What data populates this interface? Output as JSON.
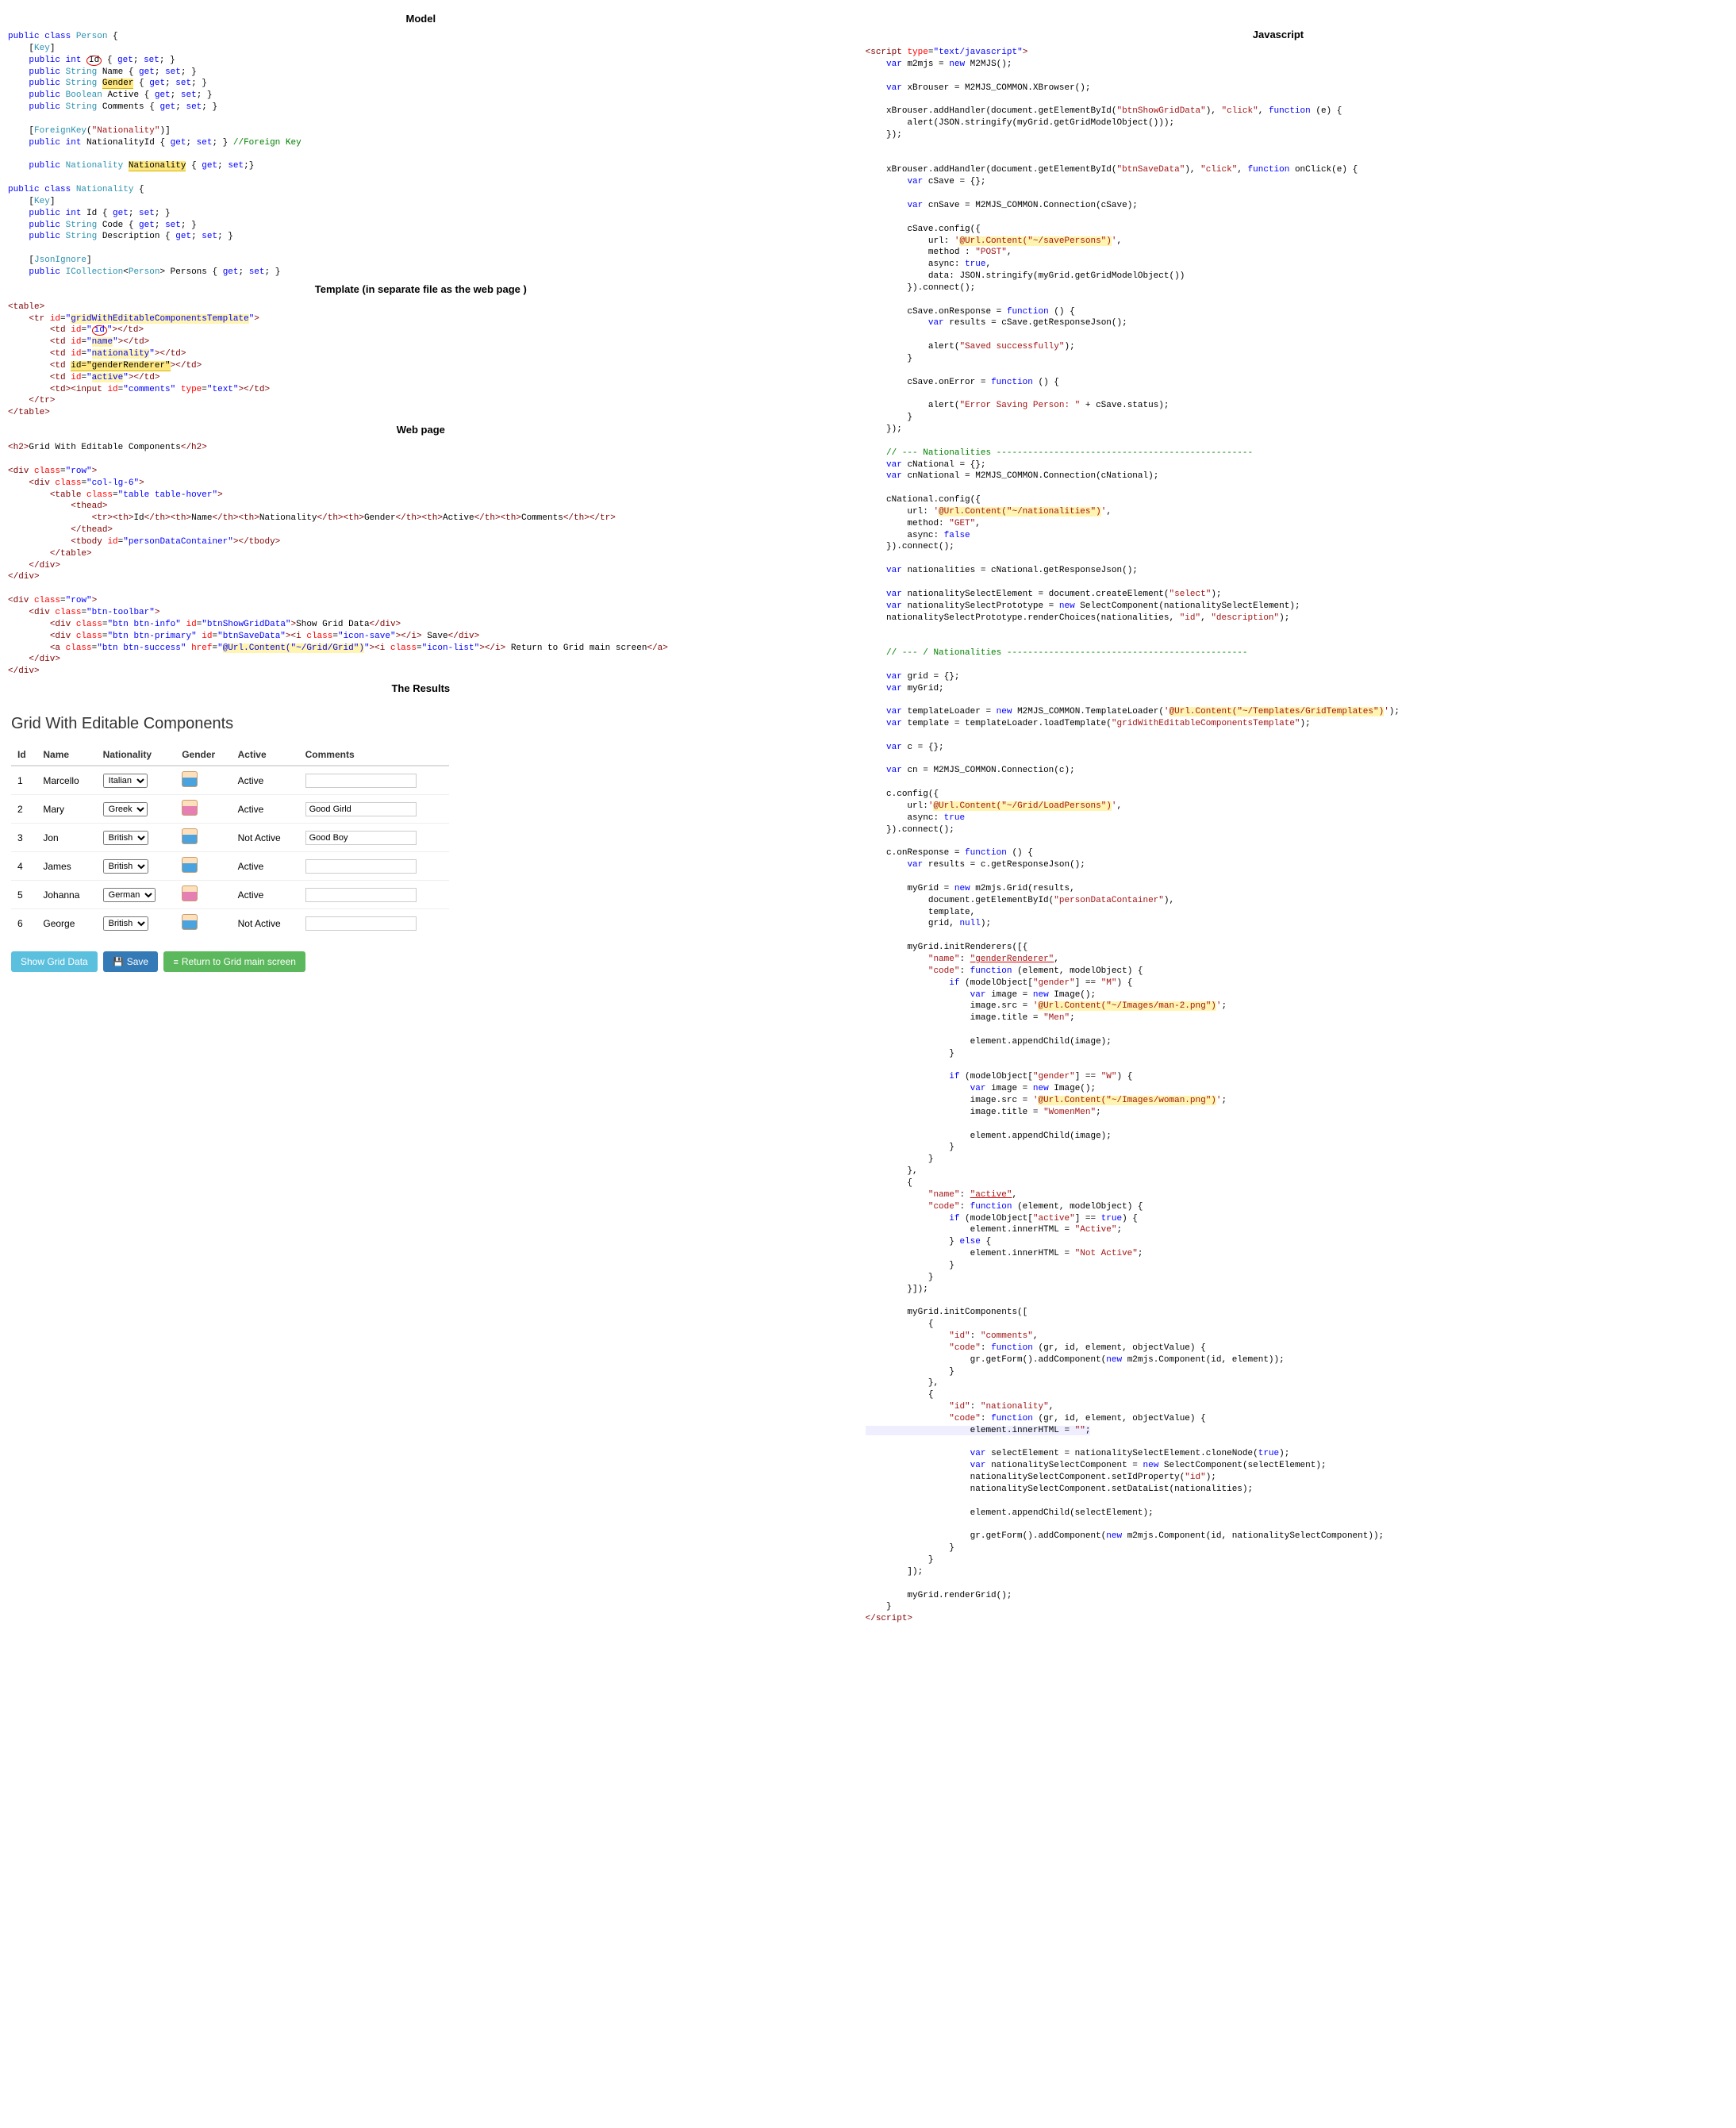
{
  "headings": {
    "model": "Model",
    "template": "Template (in separate file as the web page )",
    "webpage": "Web page",
    "results": "The Results",
    "javascript": "Javascript"
  },
  "model_code": {
    "l1": "public class Person {",
    "l2": "    [Key]",
    "l3a": "    public int ",
    "l3b": "Id",
    "l3c": " { get; set; }",
    "l4": "    public String Name { get; set; }",
    "l5a": "    public String ",
    "l5b": "Gender",
    "l5c": " { get; set; }",
    "l6": "    public Boolean Active { get; set; }",
    "l7": "    public String Comments { get; set; }",
    "l8": "",
    "l9": "    [ForeignKey(\"Nationality\")]",
    "l10a": "    public int NationalityId { get; set; } ",
    "l10b": "//Foreign Key",
    "l11": "",
    "l12a": "    public Nationality ",
    "l12b": "Nationality",
    "l12c": " { get; set;}",
    "l13": "",
    "n1": "public class Nationality {",
    "n2": "    [Key]",
    "n3": "    public int Id { get; set; }",
    "n4": "    public String Code { get; set; }",
    "n5": "    public String Description { get; set; }",
    "n6": "",
    "n7": "    [JsonIgnore]",
    "n8": "    public ICollection<Person> Persons { get; set; }"
  },
  "template_code": {
    "t1": "<table>",
    "t2": "    <tr id=\"gridWithEditableComponentsTemplate\">",
    "t3a": "        <td id=\"",
    "t3b": "id",
    "t3c": "\"></td>",
    "t4": "        <td id=\"name\"></td>",
    "t5a": "        <td id=\"",
    "t5b": "nationality",
    "t5c": "\"></td>",
    "t6a": "        <td ",
    "t6b": "id=\"genderRenderer\"",
    "t6c": "></td>",
    "t7a": "        <td id=\"",
    "t7b": "active",
    "t7c": "\"></td>",
    "t8": "        <td><input id=\"comments\" type=\"text\"></td>",
    "t9": "    </tr>",
    "t10": "</table>"
  },
  "webpage_code": {
    "w1": "<h2>Grid With Editable Components</h2>",
    "w2": "",
    "w3": "<div class=\"row\">",
    "w4": "    <div class=\"col-lg-6\">",
    "w5": "        <table class=\"table table-hover\">",
    "w6": "            <thead>",
    "w7": "                <tr><th>Id</th><th>Name</th><th>Nationality</th><th>Gender</th><th>Active</th><th>Comments</th></tr>",
    "w8": "            </thead>",
    "w9": "            <tbody id=\"personDataContainer\"></tbody>",
    "w10": "        </table>",
    "w11": "    </div>",
    "w12": "</div>",
    "w13": "",
    "w14": "<div class=\"row\">",
    "w15": "    <div class=\"btn-toolbar\">",
    "w16": "        <div class=\"btn btn-info\" id=\"btnShowGridData\">Show Grid Data</div>",
    "w17": "        <div class=\"btn btn-primary\" id=\"btnSaveData\"><i class=\"icon-save\"></i> Save</div>",
    "w18a": "        <a class=\"btn btn-success\" href=\"",
    "w18b": "@Url.Content(\"~/Grid/Grid\")",
    "w18c": "\"><i class=\"icon-list\"></i> Return to Grid main screen</a>",
    "w19": "    </div>",
    "w20": "</div>"
  },
  "results": {
    "title": "Grid With Editable Components",
    "columns": [
      "Id",
      "Name",
      "Nationality",
      "Gender",
      "Active",
      "Comments"
    ],
    "rows": [
      {
        "id": "1",
        "name": "Marcello",
        "nat": "Italian",
        "gender": "M",
        "active": "Active",
        "comments": ""
      },
      {
        "id": "2",
        "name": "Mary",
        "nat": "Greek",
        "gender": "F",
        "active": "Active",
        "comments": "Good Girld"
      },
      {
        "id": "3",
        "name": "Jon",
        "nat": "British",
        "gender": "M",
        "active": "Not Active",
        "comments": "Good Boy"
      },
      {
        "id": "4",
        "name": "James",
        "nat": "British",
        "gender": "M",
        "active": "Active",
        "comments": ""
      },
      {
        "id": "5",
        "name": "Johanna",
        "nat": "German",
        "gender": "F",
        "active": "Active",
        "comments": ""
      },
      {
        "id": "6",
        "name": "George",
        "nat": "British",
        "gender": "M",
        "active": "Not Active",
        "comments": ""
      }
    ],
    "buttons": {
      "show": "Show Grid Data",
      "save": "Save",
      "return": "Return to Grid main screen"
    }
  },
  "js": {
    "open": "<script type=\"text/javascript\">",
    "j1": "    var m2mjs = new M2MJS();",
    "j2": "",
    "j3": "    var xBrouser = M2MJS_COMMON.XBrowser();",
    "j4": "",
    "j5": "    xBrouser.addHandler(document.getElementById(\"btnShowGridData\"), \"click\", function (e) {",
    "j6": "        alert(JSON.stringify(myGrid.getGridModelObject()));",
    "j7": "    });",
    "j8": "",
    "j9": "",
    "j10": "    xBrouser.addHandler(document.getElementById(\"btnSaveData\"), \"click\", function onClick(e) {",
    "j11": "        var cSave = {};",
    "j12": "",
    "j13": "        var cnSave = M2MJS_COMMON.Connection(cSave);",
    "j14": "",
    "j15": "        cSave.config({",
    "j16a": "            url: '",
    "j16b": "@Url.Content(\"~/savePersons\")",
    "j16c": "',",
    "j17": "            method : \"POST\",",
    "j18": "            async: true,",
    "j19": "            data: JSON.stringify(myGrid.getGridModelObject())",
    "j20": "        }).connect();",
    "j21": "",
    "j22": "        cSave.onResponse = function () {",
    "j23": "            var results = cSave.getResponseJson();",
    "j24": "",
    "j25": "            alert(\"Saved successfully\");",
    "j26": "        }",
    "j27": "",
    "j28": "        cSave.onError = function () {",
    "j29": "",
    "j30": "            alert(\"Error Saving Person: \" + cSave.status);",
    "j31": "        }",
    "j32": "    });",
    "j33": "",
    "j34": "    // --- Nationalities -------------------------------------------------",
    "j35": "    var cNational = {};",
    "j36": "    var cnNational = M2MJS_COMMON.Connection(cNational);",
    "j37": "",
    "j38": "    cNational.config({",
    "j39a": "        url: '",
    "j39b": "@Url.Content(\"~/nationalities\")",
    "j39c": "',",
    "j40": "        method: \"GET\",",
    "j41": "        async: false",
    "j42": "    }).connect();",
    "j43": "",
    "j44": "    var nationalities = cNational.getResponseJson();",
    "j45": "",
    "j46": "    var nationalitySelectElement = document.createElement(\"select\");",
    "j47": "    var nationalitySelectPrototype = new SelectComponent(nationalitySelectElement);",
    "j48": "    nationalitySelectPrototype.renderChoices(nationalities, \"id\", \"description\");",
    "j49": "",
    "j50": "",
    "j51": "    // --- / Nationalities ----------------------------------------------",
    "j52": "",
    "j53": "    var grid = {};",
    "j54": "    var myGrid;",
    "j55": "",
    "j56a": "    var templateLoader = new M2MJS_COMMON.TemplateLoader('",
    "j56b": "@Url.Content(\"~/Templates/GridTemplates\")",
    "j56c": "');",
    "j57": "    var template = templateLoader.loadTemplate(\"gridWithEditableComponentsTemplate\");",
    "j58": "",
    "j59": "    var c = {};",
    "j60": "",
    "j61": "    var cn = M2MJS_COMMON.Connection(c);",
    "j62": "",
    "j63": "    c.config({",
    "j64a": "        url:'",
    "j64b": "@Url.Content(\"~/Grid/LoadPersons\")",
    "j64c": "',",
    "j65": "        async: true",
    "j66": "    }).connect();",
    "j67": "",
    "j68": "    c.onResponse = function () {",
    "j69": "        var results = c.getResponseJson();",
    "j70": "",
    "j71": "        myGrid = new m2mjs.Grid(results,",
    "j72": "            document.getElementById(\"personDataContainer\"),",
    "j73": "            template,",
    "j74": "            grid, null);",
    "j75": "",
    "j76": "        myGrid.initRenderers([{",
    "j77a": "            \"name\": ",
    "j77b": "\"genderRenderer\"",
    "j77c": ",",
    "j78": "            \"code\": function (element, modelObject) {",
    "j79": "                if (modelObject[\"gender\"] == \"M\") {",
    "j80": "                    var image = new Image();",
    "j81a": "                    image.src = '",
    "j81b": "@Url.Content(\"~/Images/man-2.png\")",
    "j81c": "';",
    "j82": "                    image.title = \"Men\";",
    "j83": "",
    "j84": "                    element.appendChild(image);",
    "j85": "                }",
    "j86": "",
    "j87": "                if (modelObject[\"gender\"] == \"W\") {",
    "j88": "                    var image = new Image();",
    "j89a": "                    image.src = '",
    "j89b": "@Url.Content(\"~/Images/woman.png\")",
    "j89c": "';",
    "j90": "                    image.title = \"WomenMen\";",
    "j91": "",
    "j92": "                    element.appendChild(image);",
    "j93": "                }",
    "j94": "            }",
    "j95": "        },",
    "j96": "        {",
    "j97a": "            \"name\": ",
    "j97b": "\"active\"",
    "j97c": ",",
    "j98": "            \"code\": function (element, modelObject) {",
    "j99": "                if (modelObject[\"active\"] == true) {",
    "j100": "                    element.innerHTML = \"Active\";",
    "j101": "                } else {",
    "j102": "                    element.innerHTML = \"Not Active\";",
    "j103": "                }",
    "j104": "            }",
    "j105": "        }]);",
    "j106": "",
    "j107": "        myGrid.initComponents([",
    "j108": "            {",
    "j109": "                \"id\": \"comments\",",
    "j110": "                \"code\": function (gr, id, element, objectValue) {",
    "j111": "                    gr.getForm().addComponent(new m2mjs.Component(id, element));",
    "j112": "                }",
    "j113": "            },",
    "j114": "            {",
    "j115": "                \"id\": \"nationality\",",
    "j116": "                \"code\": function (gr, id, element, objectValue) {",
    "j117": "                    element.innerHTML = \"\";",
    "j118": "",
    "j119": "                    var selectElement = nationalitySelectElement.cloneNode(true);",
    "j120": "                    var nationalitySelectComponent = new SelectComponent(selectElement);",
    "j121": "                    nationalitySelectComponent.setIdProperty(\"id\");",
    "j122": "                    nationalitySelectComponent.setDataList(nationalities);",
    "j123": "",
    "j124": "                    element.appendChild(selectElement);",
    "j125": "",
    "j126": "                    gr.getForm().addComponent(new m2mjs.Component(id, nationalitySelectComponent));",
    "j127": "                }",
    "j128": "            }",
    "j129": "        ]);",
    "j130": "",
    "j131": "        myGrid.renderGrid();",
    "j132": "    }",
    "close": "</script>"
  }
}
